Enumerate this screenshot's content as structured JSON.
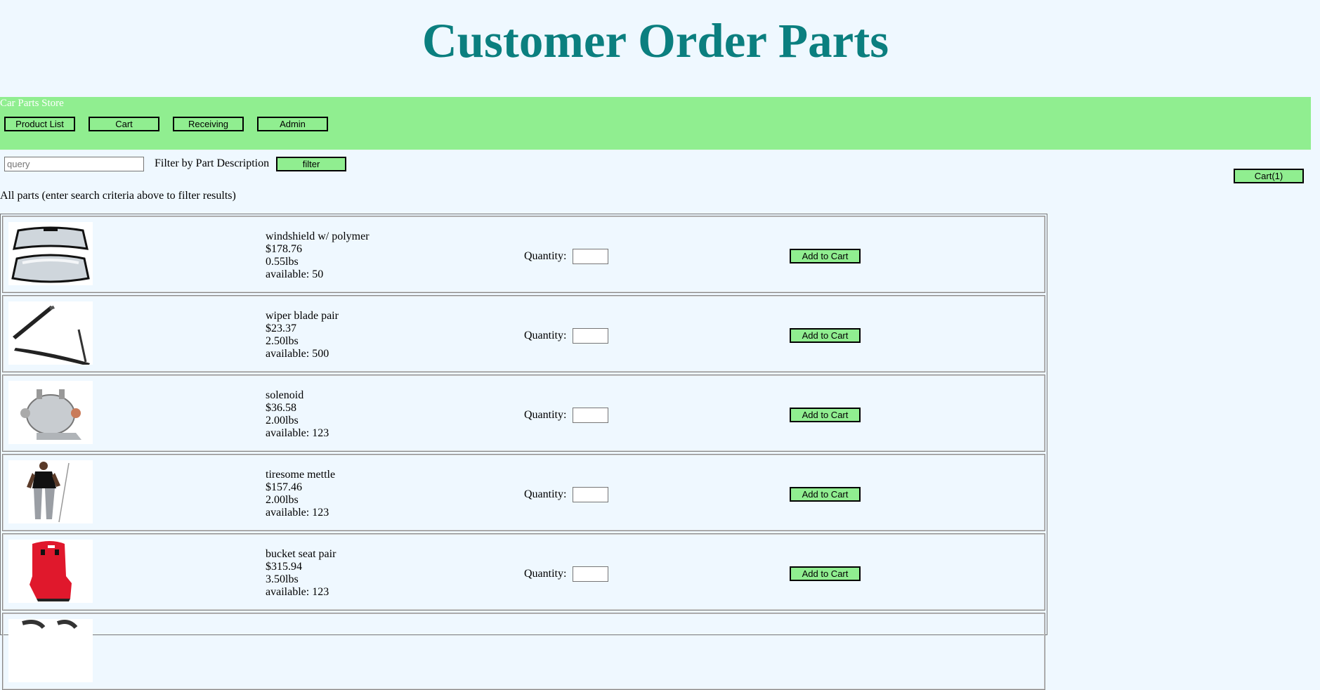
{
  "header": {
    "title": "Customer Order Parts"
  },
  "nav": {
    "store_name": "Car Parts Store",
    "items": [
      "Product List",
      "Cart",
      "Receiving",
      "Admin"
    ]
  },
  "search": {
    "placeholder": "query",
    "label": "Filter by Part Description",
    "button": "filter"
  },
  "cart_button": "Cart(1)",
  "results_note": "All parts (enter search criteria above to filter results)",
  "quantity_label": "Quantity:",
  "add_button": "Add to Cart",
  "parts": [
    {
      "name": "windshield w/ polymer",
      "price": "$178.76",
      "weight": "0.55lbs",
      "available": "available: 50",
      "icon": "windshield-icon"
    },
    {
      "name": "wiper blade pair",
      "price": "$23.37",
      "weight": "2.50lbs",
      "available": "available: 500",
      "icon": "wiper-blade-icon"
    },
    {
      "name": "solenoid",
      "price": "$36.58",
      "weight": "2.00lbs",
      "available": "available: 123",
      "icon": "solenoid-icon"
    },
    {
      "name": "tiresome mettle",
      "price": "$157.46",
      "weight": "2.00lbs",
      "available": "available: 123",
      "icon": "figure-icon"
    },
    {
      "name": "bucket seat pair",
      "price": "$315.94",
      "weight": "3.50lbs",
      "available": "available: 123",
      "icon": "bucket-seat-icon"
    }
  ]
}
